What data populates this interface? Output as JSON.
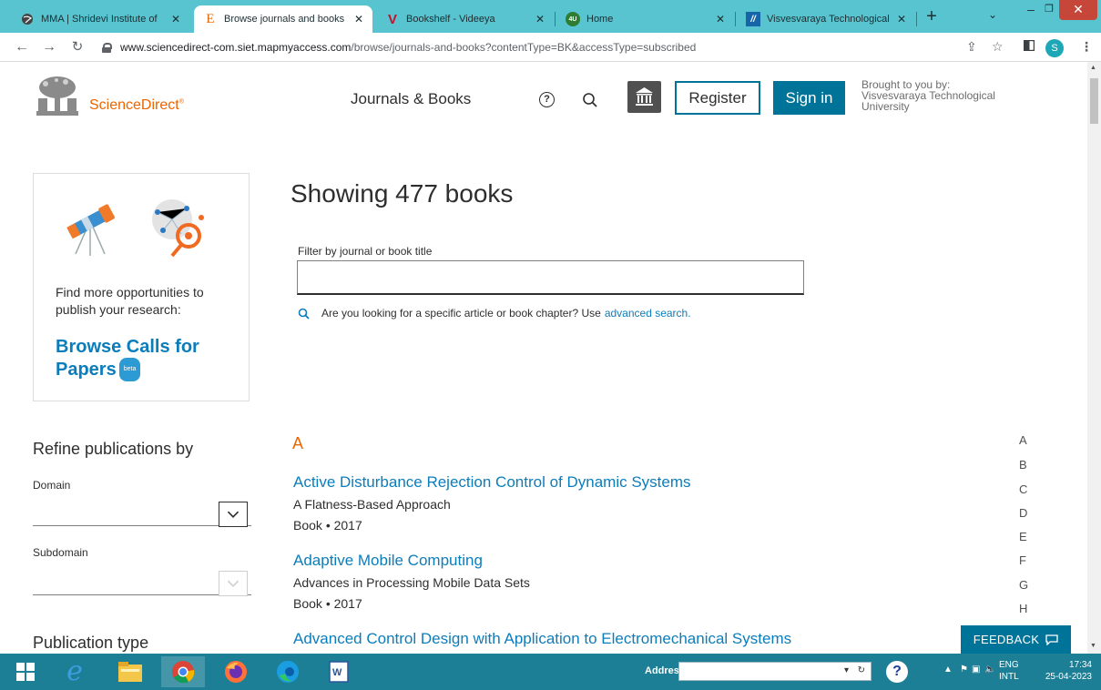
{
  "browser": {
    "tabs": [
      {
        "title": "MMA | Shridevi Institute of",
        "icon": "globe-icon"
      },
      {
        "title": "Browse journals and books",
        "icon": "elsevier-icon"
      },
      {
        "title": "Bookshelf - Videeya",
        "icon": "videeya-icon"
      },
      {
        "title": "Home",
        "icon": "home-4u-icon"
      },
      {
        "title": "Visvesvaraya Technological",
        "icon": "vtu-icon"
      }
    ],
    "url_host": "www.sciencedirect-com.siet.mapmyaccess.com",
    "url_path": "/browse/journals-and-books?contentType=BK&accessType=subscribed",
    "profile_initial": "S"
  },
  "header": {
    "brand": "ScienceDirect",
    "brand_mark": "®",
    "nav_journals": "Journals & Books",
    "register": "Register",
    "signin": "Sign in",
    "brought_by_label": "Brought to you by:",
    "institution": "Visvesvaraya Technological University"
  },
  "promo": {
    "text": "Find more opportunities to publish your research:",
    "link": "Browse Calls for Papers",
    "badge": "beta"
  },
  "listing": {
    "heading": "Showing 477 books",
    "filter_label": "Filter by journal or book title",
    "filter_value": "",
    "hint_text": "Are you looking for a specific article or book chapter? Use",
    "hint_link": "advanced search.",
    "letter": "A",
    "books": [
      {
        "title": "Active Disturbance Rejection Control of Dynamic Systems",
        "subtitle": "A Flatness-Based Approach",
        "type": "Book",
        "year": "2017"
      },
      {
        "title": "Adaptive Mobile Computing",
        "subtitle": "Advances in Processing Mobile Data Sets",
        "type": "Book",
        "year": "2017"
      },
      {
        "title": "Advanced Control Design with Application to Electromechanical Systems",
        "subtitle": "",
        "type": "",
        "year": ""
      }
    ],
    "meta_separator": "•"
  },
  "az_index": [
    "A",
    "B",
    "C",
    "D",
    "E",
    "F",
    "G",
    "H"
  ],
  "refine": {
    "heading": "Refine publications by",
    "domain_label": "Domain",
    "subdomain_label": "Subdomain",
    "pubtype_heading": "Publication type"
  },
  "feedback": "FEEDBACK",
  "taskbar": {
    "address_label": "Address",
    "lang_top": "ENG",
    "lang_bottom": "INTL",
    "time": "17:34",
    "date": "25-04-2023"
  },
  "colors": {
    "accent_orange": "#eb6500",
    "link_blue": "#0c7dbb",
    "primary_teal": "#007398",
    "tabstrip": "#57c4cf",
    "taskbar": "#1d7f95"
  }
}
